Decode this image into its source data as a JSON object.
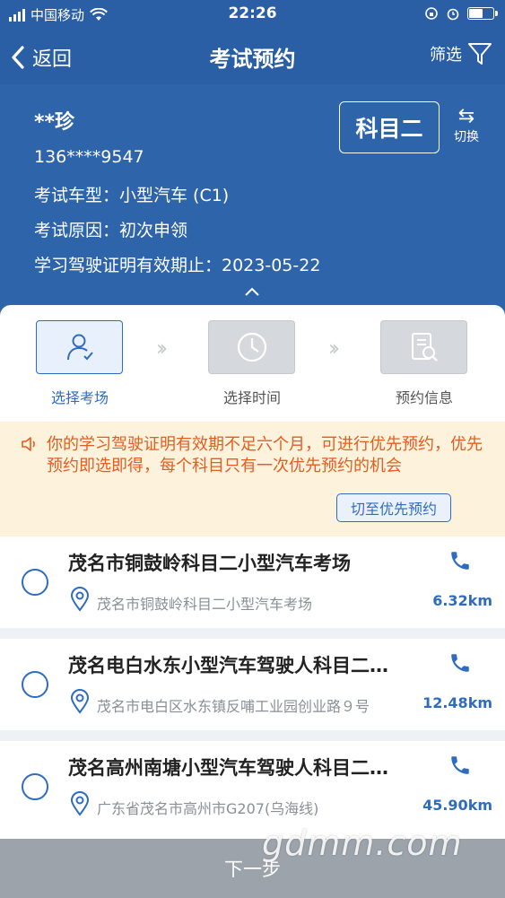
{
  "status_bar": {
    "carrier": "中国移动",
    "time": "22:26"
  },
  "nav": {
    "back_label": "返回",
    "title": "考试预约",
    "filter_label": "筛选"
  },
  "profile": {
    "name": "**珍",
    "phone": "136****9547",
    "vehicle_type": "考试车型：小型汽车 (C1)",
    "reason": "考试原因：初次申领",
    "permit_expiry": "学习驾驶证明有效期止：2023-05-22",
    "subject": "科目二",
    "switch_label": "切换"
  },
  "steps": [
    {
      "label": "选择考场",
      "active": true
    },
    {
      "label": "选择时间",
      "active": false
    },
    {
      "label": "预约信息",
      "active": false
    }
  ],
  "notice": {
    "message": "你的学习驾驶证明有效期不足六个月，可进行优先预约，优先预约即选即得，每个科目只有一次优先预约的机会",
    "priority_button": "切至优先预约",
    "color": "#e45c21"
  },
  "venues": [
    {
      "name": "茂名市铜鼓岭科目二小型汽车考场",
      "address": "茂名市铜鼓岭科目二小型汽车考场",
      "distance": "6.32km"
    },
    {
      "name": "茂名电白水东小型汽车驾驶人科目二考场",
      "address": "茂名市电白区水东镇反哺工业园创业路９号",
      "distance": "12.48km"
    },
    {
      "name": "茂名高州南塘小型汽车驾驶人科目二考场",
      "address": "广东省茂名市高州市G207(乌海线)",
      "distance": "45.90km"
    }
  ],
  "next_button": "下一步",
  "watermark": "gdmm.com",
  "colors": {
    "header": "#2d64aa",
    "accent": "#2f6cc0",
    "next_disabled": "#9da3ab"
  }
}
